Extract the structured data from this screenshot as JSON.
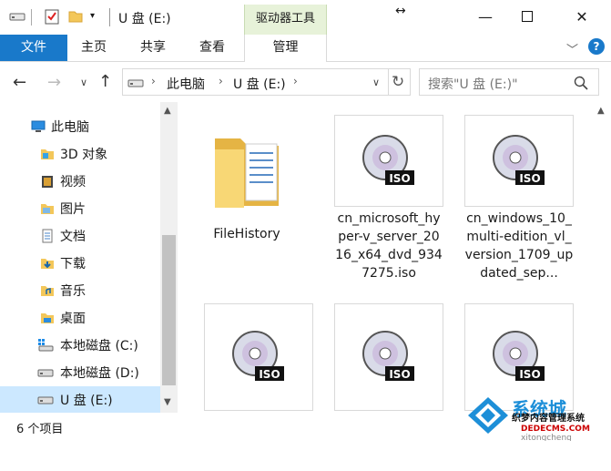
{
  "window": {
    "title": "U 盘 (E:)",
    "context_tab_title": "驱动器工具"
  },
  "ribbon": {
    "tabs": [
      "文件",
      "主页",
      "共享",
      "查看",
      "管理"
    ]
  },
  "address": {
    "crumbs": [
      "此电脑",
      "U 盘 (E:)"
    ]
  },
  "search": {
    "placeholder": "搜索\"U 盘 (E:)\""
  },
  "nav": {
    "items": [
      {
        "label": "此电脑",
        "icon": "computer-icon"
      },
      {
        "label": "3D 对象",
        "icon": "3d-objects-folder-icon"
      },
      {
        "label": "视频",
        "icon": "videos-folder-icon"
      },
      {
        "label": "图片",
        "icon": "pictures-folder-icon"
      },
      {
        "label": "文档",
        "icon": "documents-folder-icon"
      },
      {
        "label": "下载",
        "icon": "downloads-folder-icon"
      },
      {
        "label": "音乐",
        "icon": "music-folder-icon"
      },
      {
        "label": "桌面",
        "icon": "desktop-folder-icon"
      },
      {
        "label": "本地磁盘 (C:)",
        "icon": "system-drive-icon"
      },
      {
        "label": "本地磁盘 (D:)",
        "icon": "drive-icon"
      },
      {
        "label": "U 盘 (E:)",
        "icon": "usb-drive-icon"
      }
    ]
  },
  "files": [
    {
      "name": "FileHistory",
      "type": "folder"
    },
    {
      "name": "cn_microsoft_hyper-v_server_2016_x64_dvd_9347275.iso",
      "type": "iso"
    },
    {
      "name": "cn_windows_10_multi-edition_vl_version_1709_updated_sep...",
      "type": "iso"
    },
    {
      "name": "",
      "type": "iso"
    },
    {
      "name": "",
      "type": "iso"
    },
    {
      "name": "",
      "type": "iso"
    }
  ],
  "status": {
    "item_count": "6 个项目"
  },
  "watermark": {
    "text1": "系统城",
    "text2": "织梦内容管理系统",
    "text3": "DEDECMS.COM",
    "text4": "xitongcheng"
  },
  "colors": {
    "file_tab": "#1979ca",
    "context_tab": "#e7f2d9",
    "selected": "#cce8ff"
  }
}
